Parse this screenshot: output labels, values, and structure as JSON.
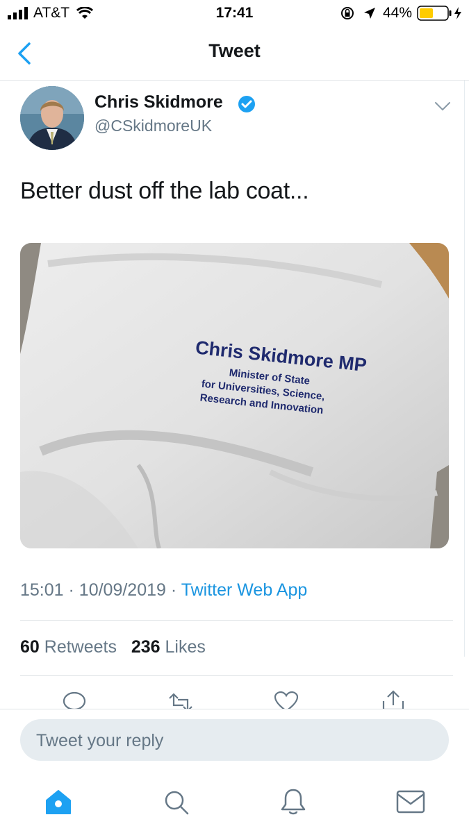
{
  "status_bar": {
    "carrier": "AT&T",
    "time": "17:41",
    "battery_percent": "44%"
  },
  "nav": {
    "title": "Tweet",
    "back_icon": "chevron-left-icon"
  },
  "tweet": {
    "author_name": "Chris Skidmore",
    "author_handle": "@CSkidmoreUK",
    "verified": true,
    "text": "Better dust off the lab coat...",
    "media": {
      "embroidery_name": "Chris Skidmore MP",
      "embroidery_line1": "Minister of State",
      "embroidery_line2": "for Universities, Science,",
      "embroidery_line3": "Research and Innovation"
    },
    "time": "15:01",
    "date": "10/09/2019",
    "source": "Twitter Web App",
    "retweets_count": "60",
    "retweets_label": "Retweets",
    "likes_count": "236",
    "likes_label": "Likes"
  },
  "reply": {
    "placeholder": "Tweet your reply"
  },
  "colors": {
    "accent": "#1da1f2",
    "link": "#1b95e0",
    "secondary_text": "#657786",
    "battery": "#ffcc00",
    "embroidery": "#1f2a6e"
  }
}
